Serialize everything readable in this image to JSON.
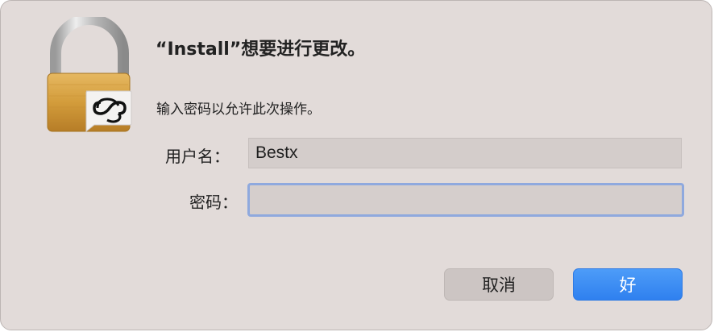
{
  "dialog": {
    "title": "“Install”想要进行更改。",
    "message": "输入密码以允许此次操作。"
  },
  "form": {
    "username_label": "用户名：",
    "username_value": "Bestx",
    "password_label": "密码：",
    "password_value": ""
  },
  "buttons": {
    "cancel_label": "取消",
    "ok_label": "好"
  },
  "icons": {
    "lock": "padlock-icon",
    "badge": "creative-cloud-icon"
  },
  "colors": {
    "dialog_background": "#e2dbd9",
    "accent": "#3a8cf5",
    "focus_ring": "#8fa9de"
  }
}
